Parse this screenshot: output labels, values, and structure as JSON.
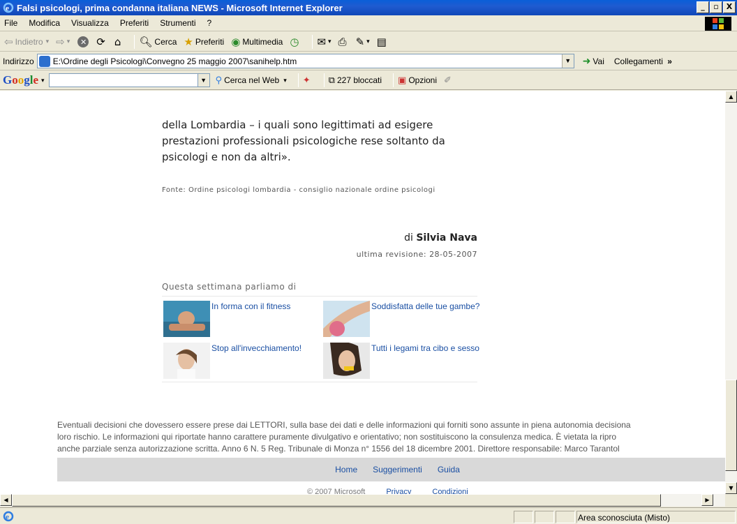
{
  "window": {
    "title": "Falsi psicologi, prima condanna italiana NEWS - Microsoft Internet Explorer",
    "minimize": "_",
    "maximize": "▫",
    "close": "X"
  },
  "menu": [
    "File",
    "Modifica",
    "Visualizza",
    "Preferiti",
    "Strumenti",
    "?"
  ],
  "toolbar": {
    "back": "Indietro",
    "search": "Cerca",
    "favorites": "Preferiti",
    "media": "Multimedia"
  },
  "address": {
    "label": "Indirizzo",
    "value": "E:\\Ordine degli Psicologi\\Convegno 25 maggio 2007\\sanihelp.htm",
    "go": "Vai",
    "links": "Collegamenti"
  },
  "google": {
    "logo": "Google",
    "search_web": "Cerca nel Web",
    "blocked": "227 bloccati",
    "options": "Opzioni"
  },
  "article": {
    "text": "della Lombardia – i quali sono legittimati ad esigere prestazioni professionali psicologiche rese soltanto da psicologi e non da altri».",
    "source": "Fonte: Ordine psicologi lombardia - consiglio nazionale ordine psicologi",
    "author_prefix": "di",
    "author_name": "Silvia Nava",
    "revision": "ultima revisione: 28-05-2007"
  },
  "week": {
    "heading": "Questa settimana parliamo di",
    "items": [
      {
        "label": "In forma con il fitness"
      },
      {
        "label": "Soddisfatta delle tue gambe?"
      },
      {
        "label": "Stop all'invecchiamento!"
      },
      {
        "label": "Tutti i legami tra cibo e sesso"
      }
    ]
  },
  "disclaimer": {
    "line1": "Eventuali decisioni che dovessero essere prese dai LETTORI, sulla base dei dati e delle informazioni qui forniti sono assunte in piena autonomia decisiona",
    "line2": "loro rischio. Le informazioni qui riportate hanno carattere puramente divulgativo e orientativo; non sostituiscono la consulenza medica. È vietata la ripro",
    "line3": "anche parziale senza autorizzazione scritta. Anno 6 N. 5 Reg. Tribunale di Monza n° 1556 del 18 dicembre 2001. Direttore responsabile: Marco Tarantol"
  },
  "footer": {
    "links": [
      "Home",
      "Suggerimenti",
      "Guida"
    ],
    "copyright": "© 2007 Microsoft",
    "privacy": "Privacy",
    "conditions": "Condizioni"
  },
  "status": {
    "zone": "Area sconosciuta (Misto)"
  }
}
